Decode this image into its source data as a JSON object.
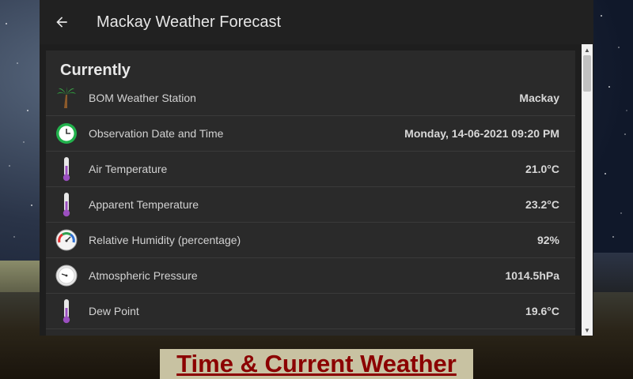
{
  "appbar": {
    "back_icon": "arrow-left-icon",
    "title": "Mackay Weather Forecast"
  },
  "card": {
    "title": "Currently",
    "rows": [
      {
        "icon": "palm-tree-icon",
        "label": "BOM Weather Station",
        "value": "Mackay"
      },
      {
        "icon": "clock-icon",
        "label": "Observation Date and Time",
        "value": "Monday, 14-06-2021 09:20 PM"
      },
      {
        "icon": "thermometer-icon",
        "label": "Air Temperature",
        "value": "21.0°C"
      },
      {
        "icon": "thermometer-icon",
        "label": "Apparent Temperature",
        "value": "23.2°C"
      },
      {
        "icon": "humidity-gauge-icon",
        "label": "Relative Humidity (percentage)",
        "value": "92%"
      },
      {
        "icon": "pressure-gauge-icon",
        "label": "Atmospheric Pressure",
        "value": "1014.5hPa"
      },
      {
        "icon": "thermometer-icon",
        "label": "Dew Point",
        "value": "19.6°C"
      }
    ]
  },
  "caption": "Time & Current Weather",
  "colors": {
    "appbar": "#212121",
    "card": "#2a2a2a",
    "caption_text": "#8b0000",
    "caption_bg": "#c8c2a2"
  }
}
